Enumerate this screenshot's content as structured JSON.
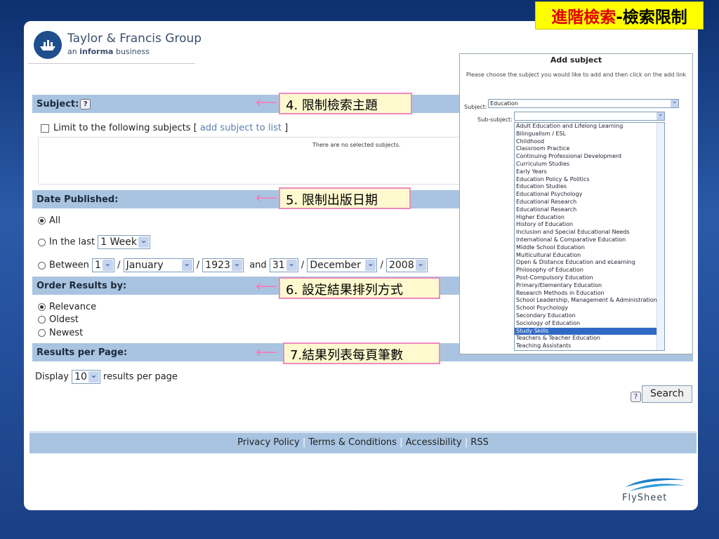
{
  "title": {
    "red": "進階檢索",
    "black": "-檢索限制"
  },
  "logo": {
    "name": "Taylor & Francis Group",
    "tagline_pre": "an ",
    "tagline_bold": "informa",
    "tagline_post": " business"
  },
  "subject": {
    "heading": "Subject:",
    "limit_label": "Limit to the following subjects [ ",
    "add_link": "add subject to list",
    "limit_close": " ]",
    "empty_text": "There are no selected subjects."
  },
  "date": {
    "heading": "Date Published:",
    "all": "All",
    "in_last": "In the last",
    "in_last_value": "1 Week",
    "between": "Between",
    "day1": "1",
    "month1": "January",
    "year1": "1923",
    "and": "and",
    "day2": "31",
    "month2": "December",
    "year2": "2008",
    "slash": "/"
  },
  "order": {
    "heading": "Order Results by:",
    "options": [
      "Relevance",
      "Oldest",
      "Newest"
    ]
  },
  "perpage": {
    "heading": "Results per Page:",
    "display": "Display",
    "value": "10",
    "suffix": "results per page"
  },
  "search": {
    "button": "Search",
    "help": "?"
  },
  "footer": {
    "links": [
      "Privacy Policy",
      "Terms & Conditions",
      "Accessibility",
      "RSS"
    ],
    "sep": "|"
  },
  "annotations": {
    "a4": "4. 限制檢索主題",
    "a5": "5. 限制出版日期",
    "a6": "6. 設定結果排列方式",
    "a7": "7.結果列表每頁筆數",
    "arrow": "⟵"
  },
  "panel": {
    "title": "Add subject",
    "instruction": "Please choose the subject you would like to add and then click on the add link",
    "subject_label": "Subject:",
    "subject_value": "Education",
    "subsubject_label": "Sub-subject:",
    "items": [
      "Adult Education and Lifelong Learning",
      "Bilingualism / ESL",
      "Childhood",
      "Classroom Practice",
      "Continuing Professional Development",
      "Curriculum Studies",
      "Early Years",
      "Education Policy & Politics",
      "Education Studies",
      "Educational Psychology",
      "Educational Research",
      "Educational Research",
      "Higher Education",
      "History of Education",
      "Inclusion and Special Educational Needs",
      "International & Comparative Education",
      "Middle School Education",
      "Multicultural Education",
      "Open & Distance Education and eLearning",
      "Philosophy of Education",
      "Post-Compulsory Education",
      "Primary/Elementary Education",
      "Research Methods in Education",
      "School Leadership, Management & Administration",
      "School Psychology",
      "Secondary Education",
      "Sociology of Education",
      "Study Skills",
      "Teachers & Teacher Education",
      "Teaching Assistants"
    ],
    "selected_index": 27
  },
  "brand": "FlySheet",
  "colors": {
    "bar": "#a9c4e0",
    "accent": "#316ac5",
    "title_bg": "#ffff00",
    "title_red": "#e00000",
    "note_border": "#ed8ac0"
  }
}
